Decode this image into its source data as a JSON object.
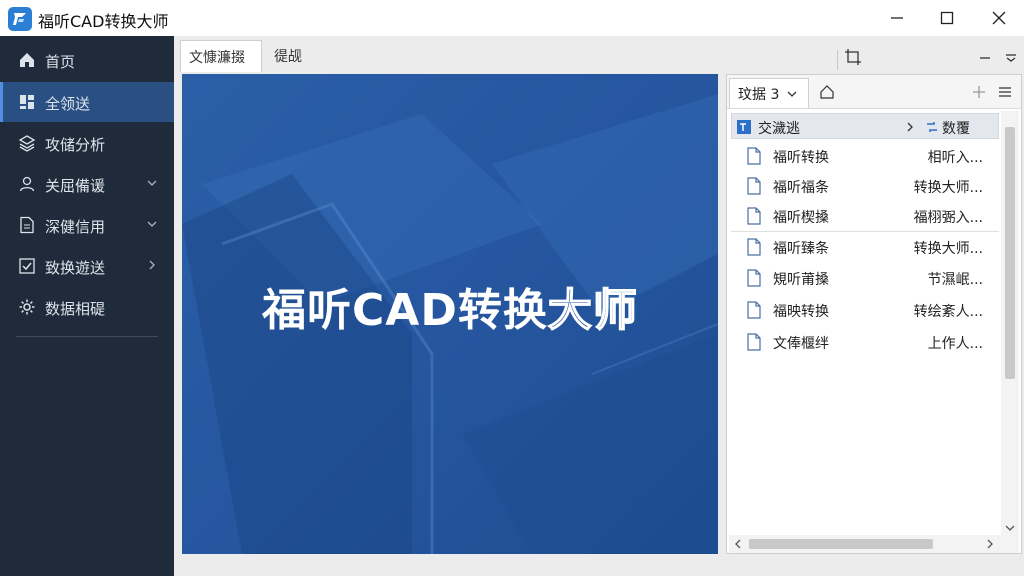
{
  "window": {
    "title": "福听CAD转换大师"
  },
  "sidebar": {
    "items": [
      {
        "label": "首页",
        "icon": "home-icon"
      },
      {
        "label": "全领送",
        "icon": "grid-icon",
        "active": true
      },
      {
        "label": "攻储分析",
        "icon": "layers-icon"
      },
      {
        "label": "关屈備谖",
        "icon": "user-icon",
        "chevron": "down"
      },
      {
        "label": "深健信用",
        "icon": "document-icon",
        "chevron": "down"
      },
      {
        "label": "致换遊送",
        "icon": "checkbox-icon",
        "chevron": "right"
      },
      {
        "label": "数据相碮",
        "icon": "gear-icon"
      }
    ]
  },
  "main": {
    "tabs": [
      {
        "label": "文慷濂掇"
      },
      {
        "label": "徥觇"
      }
    ]
  },
  "banner": {
    "title_solid": "福听CAD转换",
    "title_outline": "大师"
  },
  "panel": {
    "tab_label": "玟据 3",
    "column_left": "交濊逃",
    "column_right": "数覆",
    "rows": [
      {
        "name": "福听转换",
        "meta": "相听入..."
      },
      {
        "name": "福听福条",
        "meta": "转换大师..."
      },
      {
        "name": "福听楔搡",
        "meta": "福栩弻入..."
      },
      {
        "name": "福听臻条",
        "meta": "转换大师..."
      },
      {
        "name": "䂓听莆搡",
        "meta": "节濕岷..."
      },
      {
        "name": "福映转换",
        "meta": "转绘紊人..."
      },
      {
        "name": "文俸椻绊",
        "meta": "上作人..."
      }
    ]
  },
  "colors": {
    "sidebar_bg": "#1f2a3a",
    "accent": "#2a4f82",
    "banner": "#2657a0"
  }
}
